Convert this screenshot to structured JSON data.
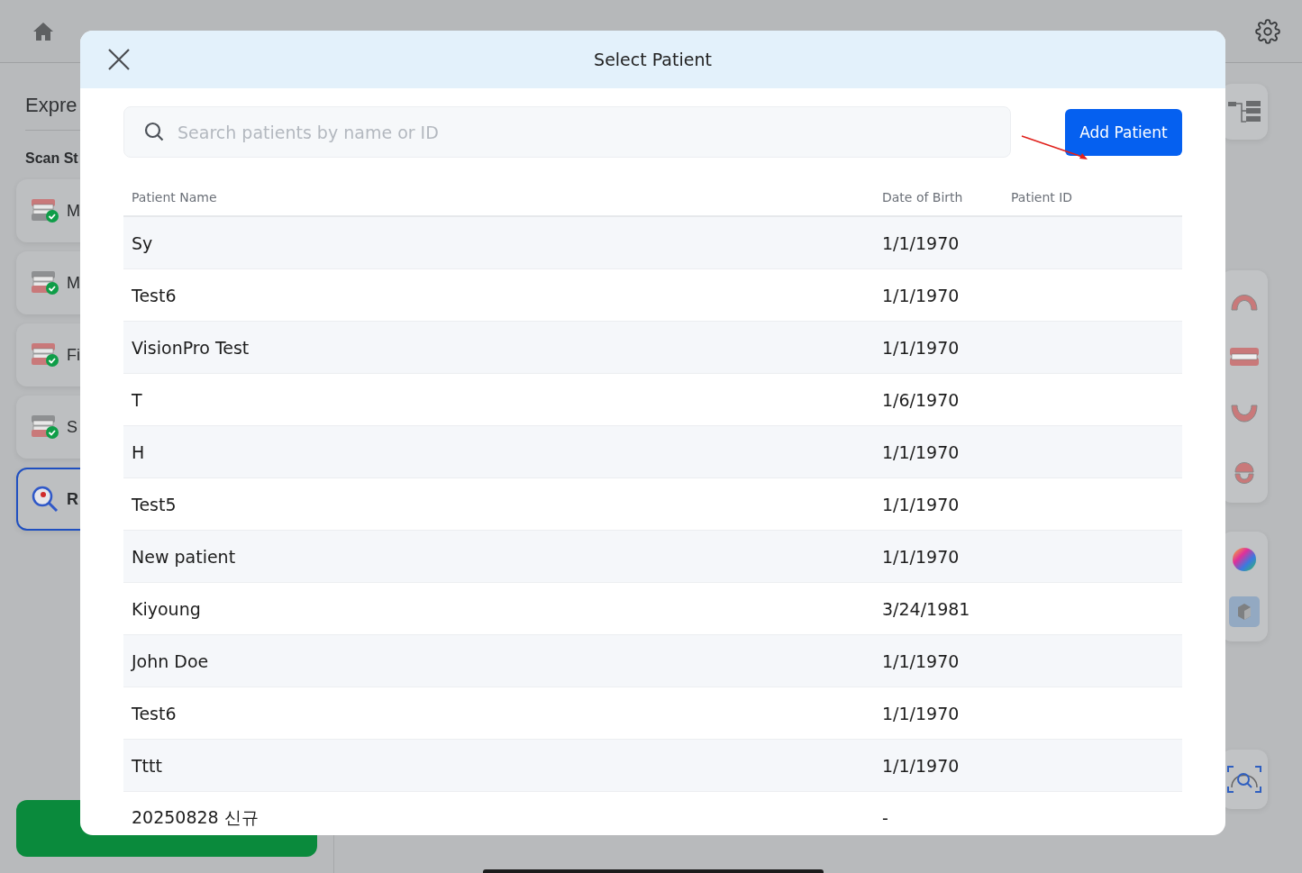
{
  "background": {
    "title": "Expre",
    "section": "Scan St",
    "steps": [
      {
        "kind": "upper",
        "label": "M",
        "selected": false
      },
      {
        "kind": "lower",
        "label": "M",
        "selected": false
      },
      {
        "kind": "bite",
        "label": "Fi",
        "selected": false
      },
      {
        "kind": "bite2",
        "label": "S",
        "selected": false
      },
      {
        "kind": "review",
        "label": "R",
        "selected": true
      }
    ]
  },
  "dialog": {
    "title": "Select Patient",
    "search": {
      "placeholder": "Search patients by name or ID"
    },
    "add_button": "Add Patient",
    "table": {
      "columns": [
        "Patient Name",
        "Date of Birth",
        "Patient ID"
      ],
      "rows": [
        {
          "name": "Sy",
          "dob": "1/1/1970"
        },
        {
          "name": "Test6",
          "dob": "1/1/1970"
        },
        {
          "name": "VisionPro Test",
          "dob": "1/1/1970"
        },
        {
          "name": "T",
          "dob": "1/6/1970"
        },
        {
          "name": "H",
          "dob": "1/1/1970"
        },
        {
          "name": "Test5",
          "dob": "1/1/1970"
        },
        {
          "name": "New patient",
          "dob": "1/1/1970"
        },
        {
          "name": "Kiyoung",
          "dob": "3/24/1981"
        },
        {
          "name": "John Doe",
          "dob": "1/1/1970"
        },
        {
          "name": "Test6",
          "dob": "1/1/1970"
        },
        {
          "name": "Tttt",
          "dob": "1/1/1970"
        },
        {
          "name": "20250828 신규",
          "dob": "-"
        }
      ]
    }
  }
}
